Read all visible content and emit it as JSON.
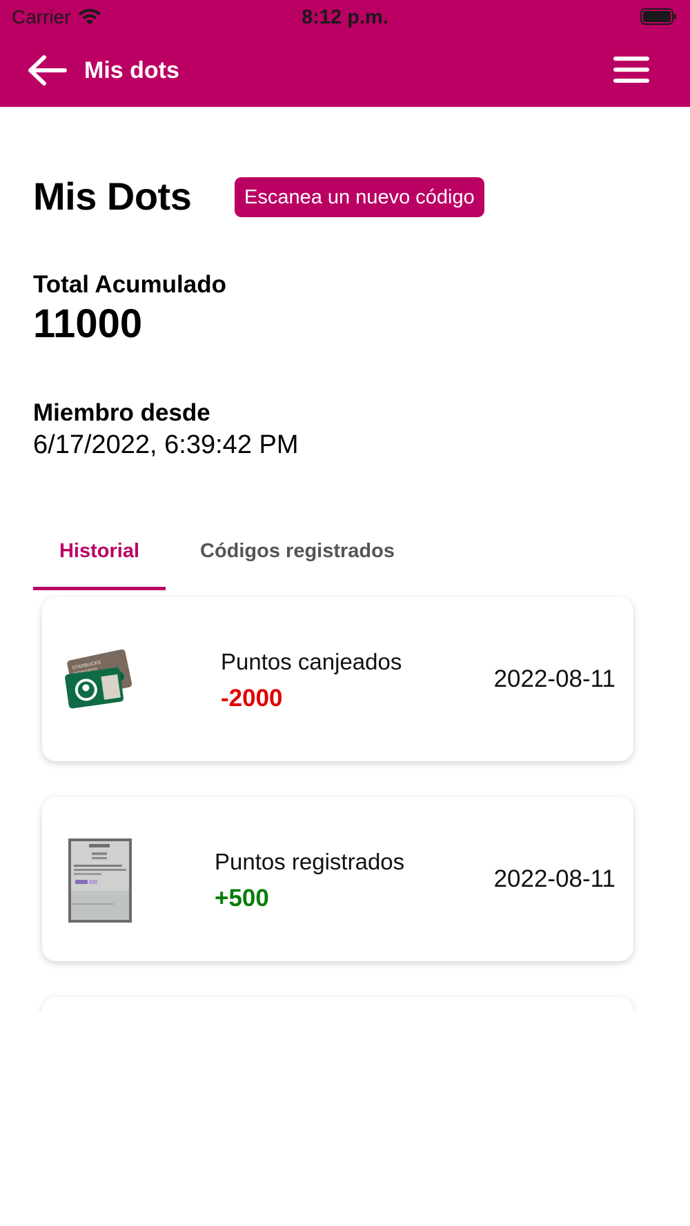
{
  "status_bar": {
    "carrier": "Carrier",
    "time": "8:12 p.m."
  },
  "header": {
    "title": "Mis dots",
    "back_icon": "arrow-left-icon",
    "menu_icon": "hamburger-menu-icon",
    "background_color": "#bb0063"
  },
  "main": {
    "title": "Mis Dots",
    "scan_button_label": "Escanea un nuevo código",
    "total_label": "Total Acumulado",
    "total_value": "11000",
    "member_label": "Miembro desde",
    "member_value": "6/17/2022, 6:39:42 PM"
  },
  "tabs": [
    {
      "label": "Historial",
      "active": true
    },
    {
      "label": "Códigos registrados",
      "active": false
    }
  ],
  "history": [
    {
      "title": "Puntos canjeados",
      "points": "-2000",
      "points_color": "#e00000",
      "date": "2022-08-11",
      "thumbnail": "starbucks-rewards-card-image"
    },
    {
      "title": "Puntos registrados",
      "points": "+500",
      "points_color": "#0a7d0a",
      "date": "2022-08-11",
      "thumbnail": "receipt-photo-image"
    }
  ],
  "colors": {
    "accent": "#bb0063",
    "negative": "#e00000",
    "positive": "#0a7d0a"
  }
}
